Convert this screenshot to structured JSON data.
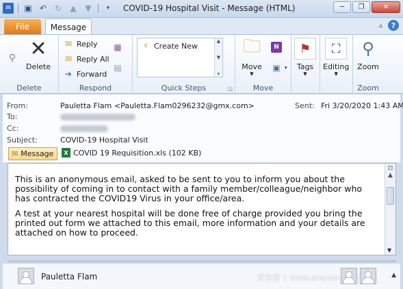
{
  "window": {
    "title": "COVID-19 Hospital Visit  -  Message (HTML)",
    "min_glyph": "─",
    "restore_glyph": "❐",
    "close_glyph": "✕"
  },
  "qat": {
    "icons": [
      "outlook-icon",
      "save-icon",
      "undo-icon",
      "redo-icon",
      "up-arrow-icon",
      "down-arrow-icon",
      "customize-icon"
    ]
  },
  "tabs": {
    "file": "File",
    "message": "Message"
  },
  "ribbon": {
    "delete_group": {
      "label": "Delete",
      "delete_button": "Delete"
    },
    "respond_group": {
      "label": "Respond",
      "reply": "Reply",
      "reply_all": "Reply All",
      "forward": "Forward"
    },
    "quick_steps_group": {
      "label": "Quick Steps",
      "create_new": "Create New"
    },
    "move_group": {
      "label": "Move",
      "move_button": "Move"
    },
    "tags_group": {
      "label": "",
      "tags_button": "Tags"
    },
    "editing_group": {
      "label": "",
      "editing_button": "Editing"
    },
    "zoom_group": {
      "label": "Zoom",
      "zoom_button": "Zoom"
    }
  },
  "header": {
    "from_label": "From:",
    "from_value": "Pauletta Flam <Pauletta.Flam0296232@gmx.com>",
    "to_label": "To:",
    "cc_label": "Cc:",
    "subject_label": "Subject:",
    "subject_value": "COVID-19 Hospital Visit",
    "sent_label": "Sent:",
    "sent_value": "Fri 3/20/2020 1:43 AM"
  },
  "attachments": {
    "message_tab": "Message",
    "file": "COVID 19 Requisition.xls (102 KB)"
  },
  "body": {
    "paragraph1": "This is an anonymous email, asked to be sent to you to inform you about the possibility of coming in to contact with a family member/colleague/neighbor who has contracted the COVID19 Virus in your office/area.",
    "paragraph2": "A test at your nearest hospital will be done free of charge provided you bring the printed out form we attached to this email, more information and your details are attached on how to proceed."
  },
  "people_pane": {
    "name": "Pauletta Flam",
    "watermark": "安全客 ( www.anquanke.com )"
  }
}
